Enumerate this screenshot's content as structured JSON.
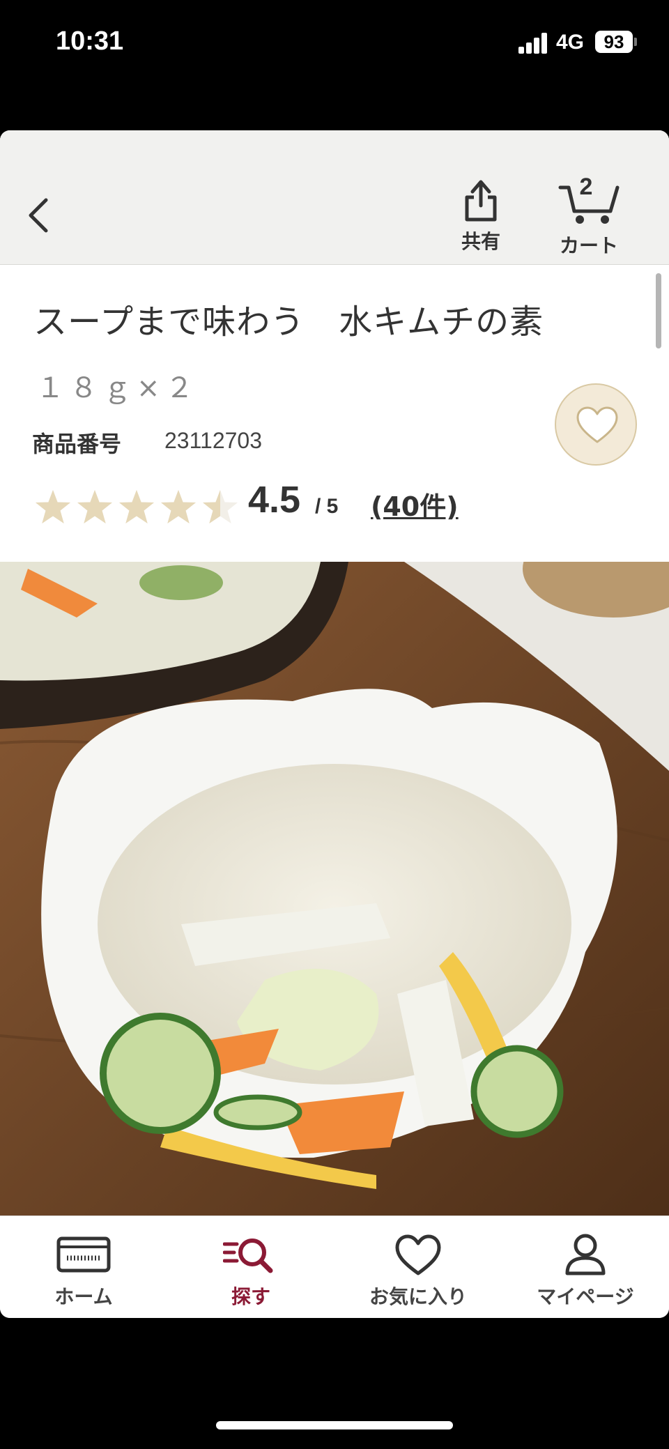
{
  "status_bar": {
    "time": "10:31",
    "network": "4G",
    "battery": "93"
  },
  "header": {
    "share_label": "共有",
    "cart_label": "カート",
    "cart_count": "2"
  },
  "product": {
    "title": "スープまで味わう　水キムチの素",
    "volume": "１８ｇ×２",
    "code_label": "商品番号",
    "code_value": "23112703",
    "rating": "4.5",
    "rating_max": "/ 5",
    "review_count": "(40件)",
    "rating_value": 4.5
  },
  "bottom_nav": {
    "items": [
      {
        "label": "ホーム",
        "icon": "home-card-icon",
        "active": false
      },
      {
        "label": "探す",
        "icon": "search-list-icon",
        "active": true
      },
      {
        "label": "お気に入り",
        "icon": "heart-icon",
        "active": false
      },
      {
        "label": "マイページ",
        "icon": "user-icon",
        "active": false
      }
    ]
  },
  "colors": {
    "accent": "#8b1a35",
    "star": "#e6d8b8",
    "header_bg": "#f1f1ef",
    "favorite_bg": "#f3ead8"
  }
}
